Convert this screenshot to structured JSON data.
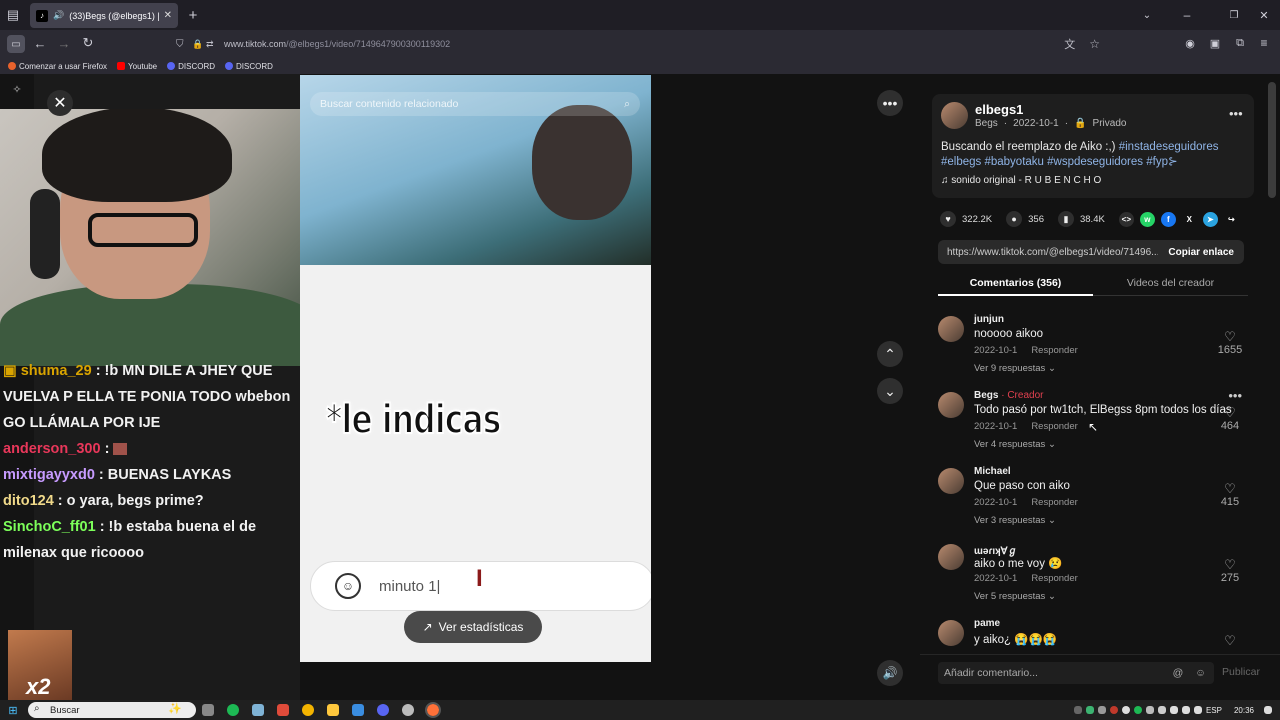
{
  "browser": {
    "tab_title": "(33)Begs (@elbegs1) | TikTo",
    "tab_close": "✕",
    "new_tab": "+",
    "url_host": "www.tiktok.com",
    "url_path": "/@elbegs1/video/7149647900300119302",
    "bookmarks": [
      {
        "label": "Comenzar a usar Firefox",
        "color": "#e8622c"
      },
      {
        "label": "Youtube",
        "color": "#ff0000"
      },
      {
        "label": "DISCORD",
        "color": "#5865f2"
      },
      {
        "label": "DISCORD",
        "color": "#5865f2"
      }
    ]
  },
  "stream": {
    "close": "✕",
    "chat": [
      {
        "user": "shuma_29",
        "user_color": "#d9a400",
        "message": ": !b MN DILE A JHEY QUE VUELVA P ELLA TE PONIA TODO wbebon GO LLÁMALA POR IJE"
      },
      {
        "user": "anderson_300",
        "user_color": "#e8375a",
        "message": ":"
      },
      {
        "user": "mixtigayyxd0",
        "user_color": "#c79bff",
        "message": ": BUENAS LAYKAS"
      },
      {
        "user": "dito124",
        "user_color": "#f0d98a",
        "message": ": o yara, begs prime?"
      },
      {
        "user": "SinchoC_ff01",
        "user_color": "#7cff5a",
        "message": ": !b estaba buena el de milenax que ricoooo"
      }
    ],
    "emote_text": "x2"
  },
  "video": {
    "search_placeholder": "Buscar contenido relacionado",
    "caption": "*le indicas",
    "input_text": "minuto 1|",
    "stats_button": "Ver estadísticas"
  },
  "post": {
    "username": "elbegs1",
    "display_name": "Begs",
    "date": "2022-10-1",
    "privacy": "Privado",
    "description": "Buscando el reemplazo de Aiko :,)",
    "hashtags_line1": "#instadeseguidores",
    "hashtags_line2": "#elbegs #babyotaku #wspdeseguidores #fyp⊱",
    "sound": "sonido original - R U B E N C H O",
    "likes": "322.2K",
    "comments": "356",
    "saves": "38.4K",
    "link": "https://www.tiktok.com/@elbegs1/video/71496...",
    "copy_link": "Copiar enlace",
    "tab_comments": "Comentarios (356)",
    "tab_videos": "Videos del creador"
  },
  "comments": [
    {
      "user": "junjun",
      "creator": "",
      "text": "nooooo aikoo",
      "date": "2022-10-1",
      "reply": "Responder",
      "replies": "Ver 9 respuestas",
      "likes": "1655"
    },
    {
      "user": "Begs",
      "creator": " · Creador",
      "text": "Todo pasó por tw1tch, ElBegss 8pm todos los días",
      "date": "2022-10-1",
      "reply": "Responder",
      "replies": "Ver 4 respuestas",
      "likes": "464"
    },
    {
      "user": "Michael",
      "creator": "",
      "text": "Que paso con aiko",
      "date": "2022-10-1",
      "reply": "Responder",
      "replies": "Ver 3 respuestas",
      "likes": "415"
    },
    {
      "user": "ɯǝɾıʞ∀ℊ",
      "creator": "",
      "text": "aiko o me voy 😢",
      "date": "2022-10-1",
      "reply": "Responder",
      "replies": "Ver 5 respuestas",
      "likes": "275"
    },
    {
      "user": "pame",
      "creator": "",
      "text": "y aiko¿ 😭😭😭",
      "date": "",
      "reply": "",
      "replies": "",
      "likes": ""
    }
  ],
  "comment_box": {
    "placeholder": "Añadir comentario...",
    "publish": "Publicar"
  },
  "taskbar": {
    "search": "Buscar",
    "language": "ESP",
    "time": "20:36"
  },
  "colors": {
    "accent_creator": "#e0404f",
    "hashtag": "#8fb4e6"
  }
}
